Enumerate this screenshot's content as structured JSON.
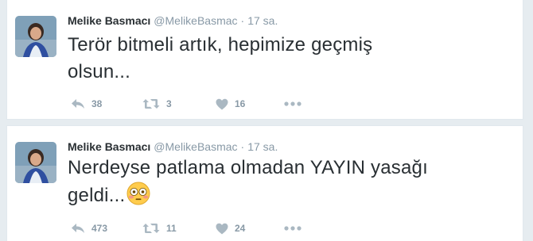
{
  "colors": {
    "background": "#e6ecf0",
    "card": "#ffffff",
    "text": "#292f33",
    "muted": "#8899a6",
    "icon": "#aab8c2"
  },
  "tweets": [
    {
      "fullname": "Melike Basmacı",
      "username": "@MelikeBasmac",
      "dot": "·",
      "time": "17 sa.",
      "text_line1": "Terör bitmeli artık, hepimize geçmiş",
      "text_line2": "olsun...",
      "emoji": "",
      "reply_count": "38",
      "retweet_count": "3",
      "like_count": "16",
      "icons": [
        "reply-icon",
        "retweet-icon",
        "heart-icon",
        "more-icon"
      ]
    },
    {
      "fullname": "Melike Basmacı",
      "username": "@MelikeBasmac",
      "dot": "·",
      "time": "17 sa.",
      "text_line1": "Nerdeyse patlama olmadan YAYIN yasağı",
      "text_line2": "geldi...",
      "emoji": "flushed-face-emoji",
      "reply_count": "473",
      "retweet_count": "11",
      "like_count": "24",
      "icons": [
        "reply-icon",
        "retweet-icon",
        "heart-icon",
        "more-icon"
      ]
    }
  ]
}
